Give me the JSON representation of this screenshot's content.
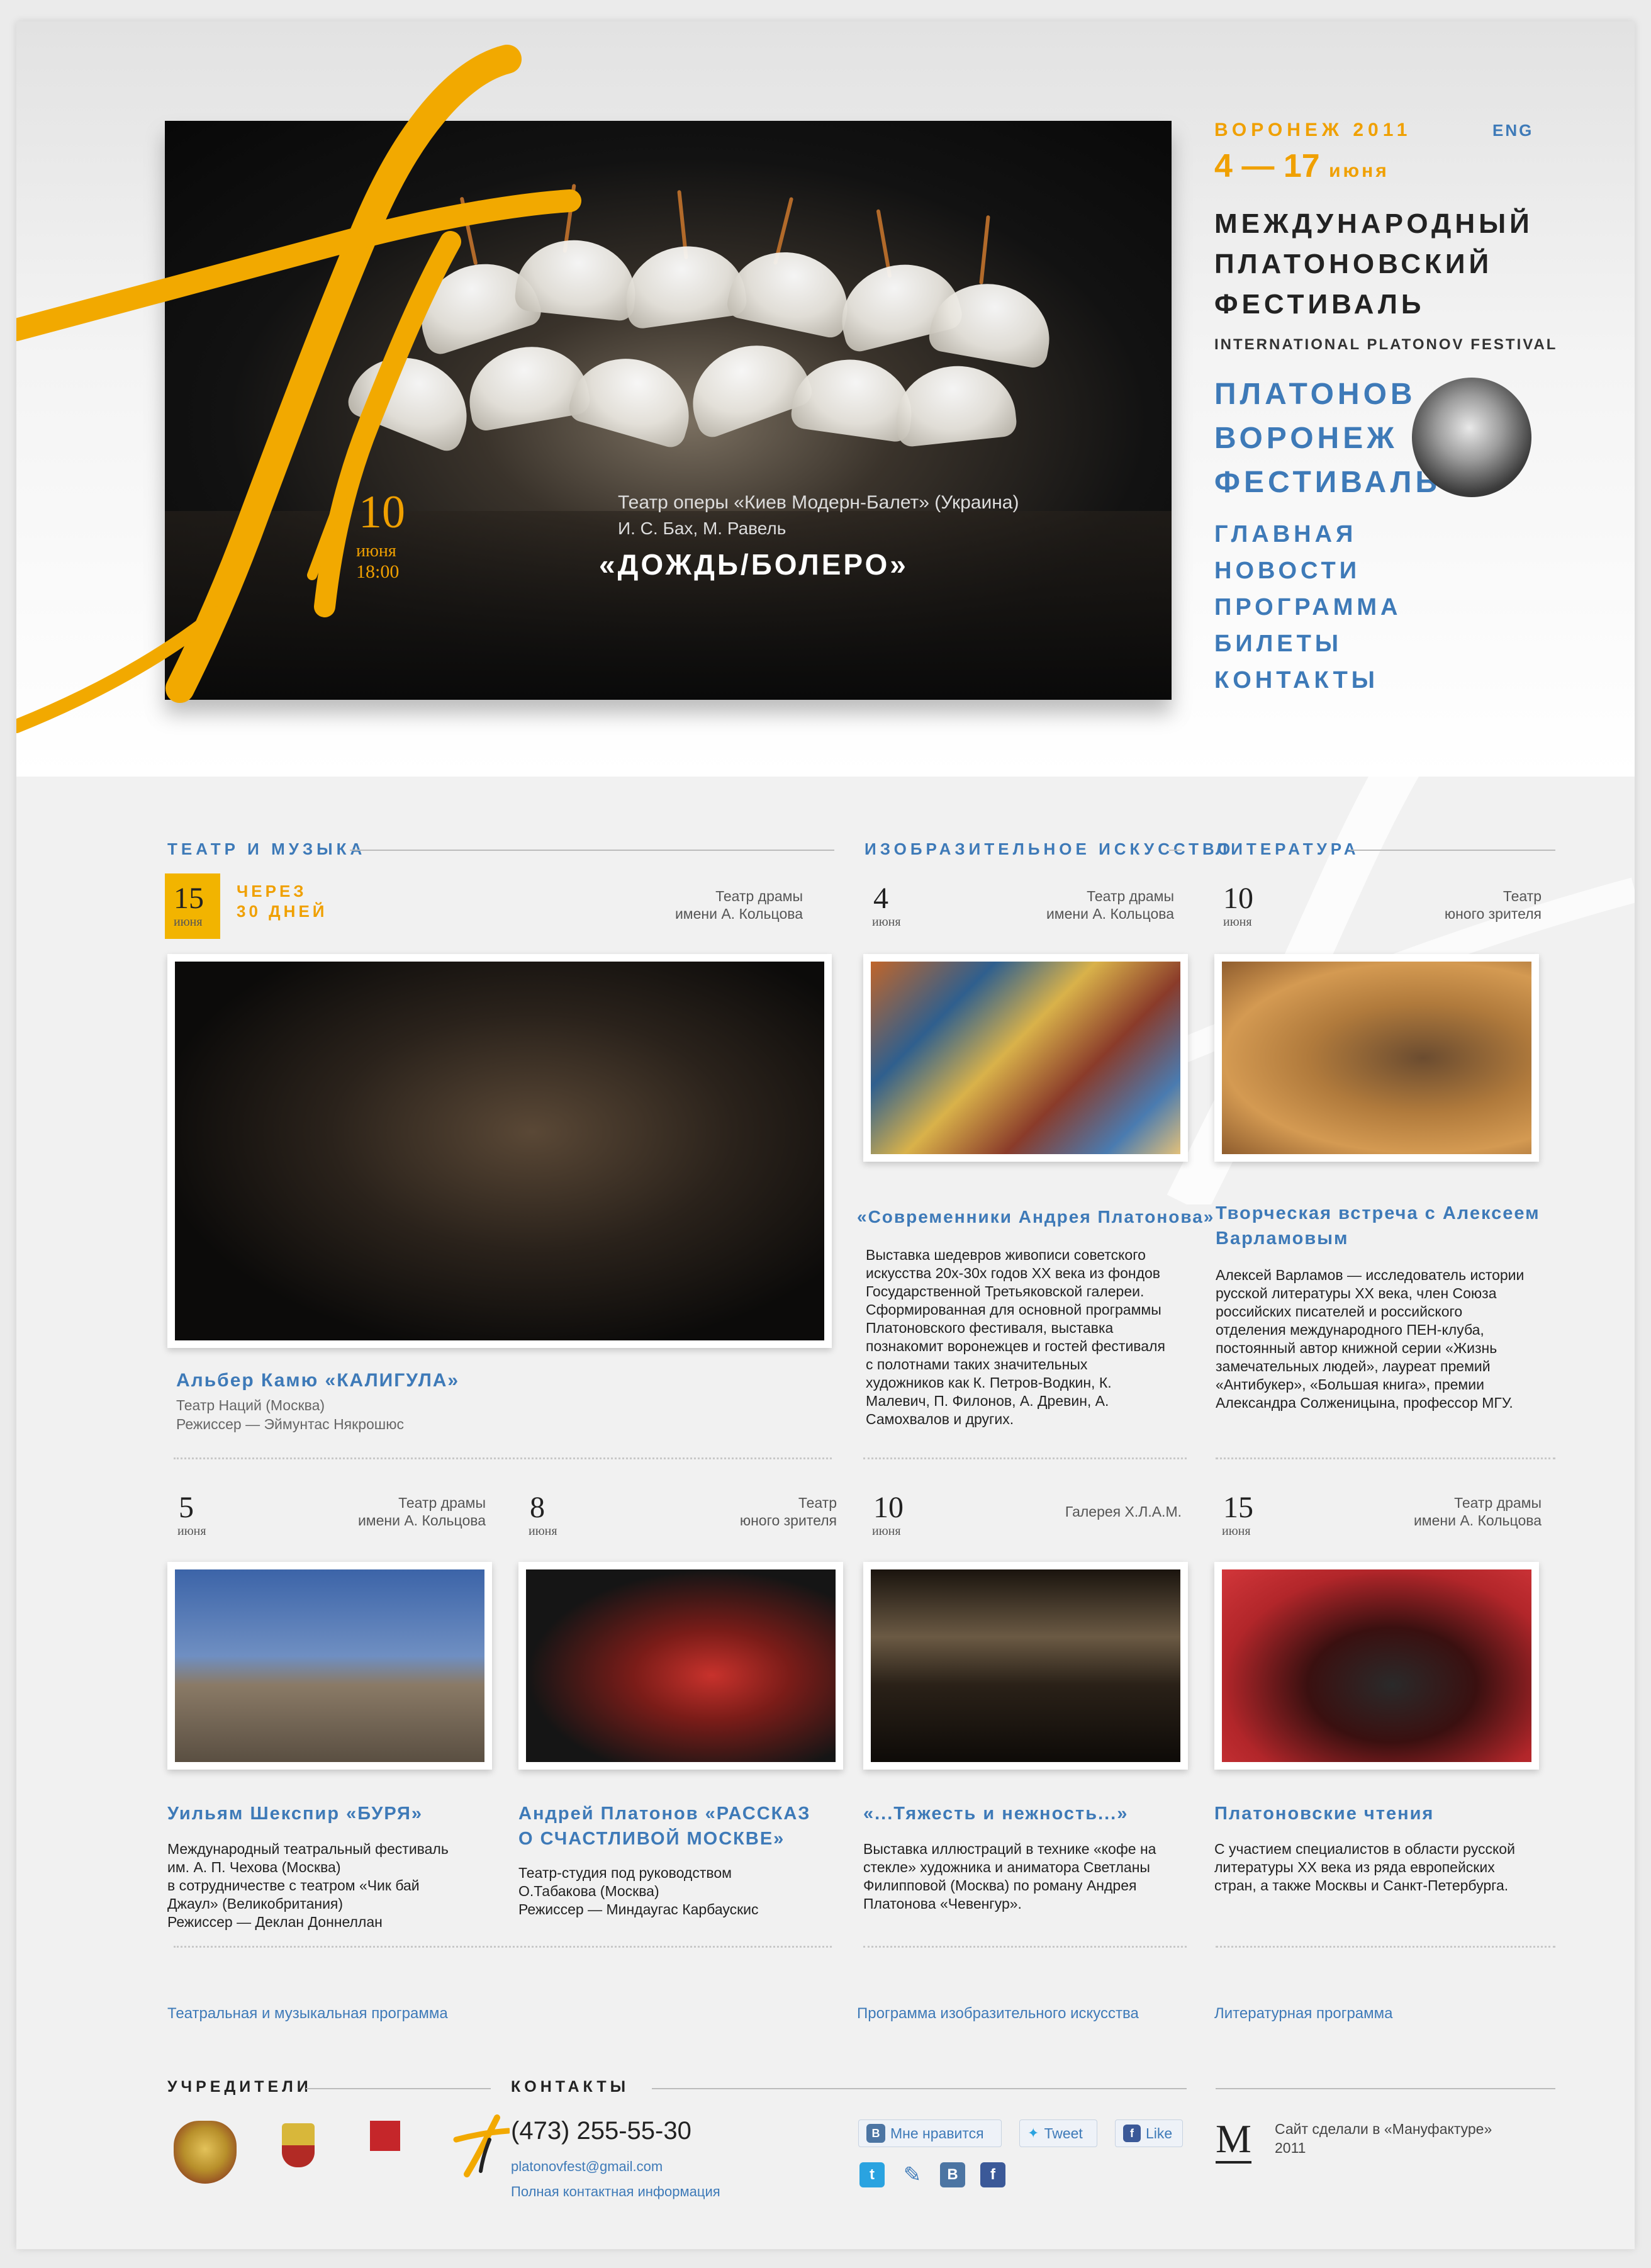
{
  "header": {
    "city_year": "ВОРОНЕЖ 2011",
    "lang": "ENG",
    "dates_main": "4 — 17",
    "dates_month": "июня",
    "festival_name": [
      "МЕЖДУНАРОДНЫЙ",
      "ПЛАТОНОВСКИЙ",
      "ФЕСТИВАЛЬ"
    ],
    "festival_name_en": "INTERNATIONAL PLATONOV FESTIVAL",
    "platonov_links": [
      "ПЛАТОНОВ",
      "ВОРОНЕЖ",
      "ФЕСТИВАЛЬ"
    ],
    "nav": [
      "ГЛАВНАЯ",
      "НОВОСТИ",
      "ПРОГРАММА",
      "БИЛЕТЫ",
      "КОНТАКТЫ"
    ]
  },
  "hero": {
    "day": "10",
    "month": "июня",
    "time": "18:00",
    "company": "Театр оперы «Киев Модерн-Балет» (Украина)",
    "composers": "И. С. Бах, М. Равель",
    "title": "«ДОЖДЬ/БОЛЕРО»"
  },
  "sections": {
    "theatre": "ТЕАТР И МУЗЫКА",
    "art": "ИЗОБРАЗИТЕЛЬНОЕ ИСКУССТВО",
    "literature": "ЛИТЕРАТУРА"
  },
  "featured": {
    "day": "15",
    "month": "июня",
    "countdown": [
      "ЧЕРЕЗ",
      "30 ДНЕЙ"
    ],
    "venue": [
      "Театр драмы",
      "имени А. Кольцова"
    ],
    "title": "Альбер Камю «КАЛИГУЛА»",
    "company": "Театр Наций (Москва)",
    "director": "Режиссер — Эймунтас Някрошюс"
  },
  "art_event": {
    "day": "4",
    "month": "июня",
    "venue": [
      "Театр драмы",
      "имени А. Кольцова"
    ],
    "title": "«Современники Андрея Платонова»",
    "desc": [
      "Выставка шедевров живописи советского",
      "искусства 20х-30х годов XX века из фондов",
      "Государственной Третьяковской галереи.",
      "Сформированная для основной программы",
      "Платоновского фестиваля, выставка",
      "познакомит воронежцев и гостей фестиваля",
      "с полотнами таких значительных",
      "художников как К. Петров-Водкин, К.",
      "Малевич, П. Филонов, А. Древин, А.",
      "Самохвалов и других."
    ]
  },
  "lit_event": {
    "day": "10",
    "month": "июня",
    "venue": [
      "Театр",
      "юного зрителя"
    ],
    "title": [
      "Творческая встреча с Алексеем",
      "Варламовым"
    ],
    "desc": [
      "Алексей Варламов — исследователь истории",
      "русской литературы XX века, член Союза",
      "российских писателей и российского",
      "отделения международного ПЕН-клуба,",
      "постоянный автор книжной серии «Жизнь",
      "замечательных людей», лауреат премий",
      "«Антибукер», «Большая книга», премии",
      "Александра Солженицына, профессор МГУ."
    ]
  },
  "row2": [
    {
      "day": "5",
      "month": "июня",
      "venue": [
        "Театр драмы",
        "имени А. Кольцова"
      ],
      "title": [
        "Уильям Шекспир «БУРЯ»"
      ],
      "desc": [
        "Международный театральный фестиваль",
        "им. А. П. Чехова (Москва)",
        "в сотрудничестве с театром «Чик бай",
        "Джаул» (Великобритания)",
        "Режиссер — Деклан Доннеллан"
      ]
    },
    {
      "day": "8",
      "month": "июня",
      "venue": [
        "Театр",
        "юного зрителя"
      ],
      "title": [
        "Андрей Платонов «РАССКАЗ",
        "О СЧАСТЛИВОЙ МОСКВЕ»"
      ],
      "desc": [
        "Театр-студия под руководством",
        "О.Табакова (Москва)",
        "Режиссер — Миндаугас Карбаускис"
      ]
    },
    {
      "day": "10",
      "month": "июня",
      "venue": [
        "Галерея Х.Л.А.М."
      ],
      "title": [
        "«...Тяжесть и нежность...»"
      ],
      "desc": [
        "Выставка иллюстраций в технике «кофе на",
        "стекле» художника и аниматора Светланы",
        "Филипповой (Москва) по роману Андрея",
        "Платонова «Чевенгур»."
      ]
    },
    {
      "day": "15",
      "month": "июня",
      "venue": [
        "Театр драмы",
        "имени А. Кольцова"
      ],
      "title": [
        "Платоновские чтения"
      ],
      "desc": [
        "С участием специалистов в области русской",
        "литературы XX века из ряда европейских",
        "стран, а также Москвы и Санкт-Петербурга."
      ]
    }
  ],
  "program_links": [
    "Театральная и музыкальная программа",
    "Программа изобразительного искусства",
    "Литературная программа"
  ],
  "footer": {
    "founders": "УЧРЕДИТЕЛИ",
    "contacts": "КОНТАКТЫ",
    "phone": "(473) 255-55-30",
    "email": "platonovfest@gmail.com",
    "contacts_link": "Полная контактная информация",
    "vk_like": "Мне нравится",
    "tweet": "Tweet",
    "fb_like": "Like",
    "credit": "Сайт сделали в «Мануфактуре»",
    "year": "2011",
    "logo_letter": "М"
  },
  "colors": {
    "accent_orange": "#f0a000",
    "link_blue": "#3e7ab8",
    "date_box": "#f2b400"
  }
}
